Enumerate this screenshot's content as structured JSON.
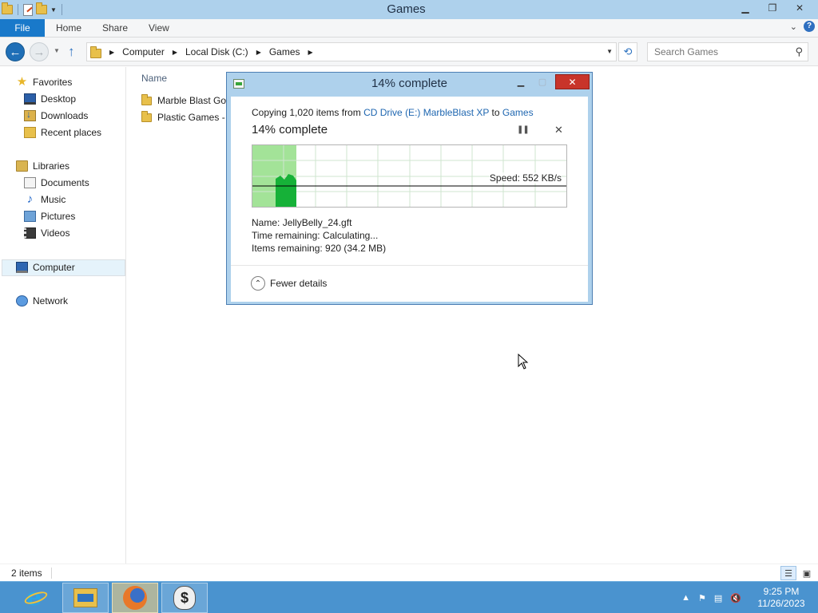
{
  "window": {
    "title": "Games"
  },
  "ribbon": {
    "tabs": [
      "File",
      "Home",
      "Share",
      "View"
    ]
  },
  "address": {
    "crumbs": [
      "Computer",
      "Local Disk (C:)",
      "Games"
    ]
  },
  "search": {
    "placeholder": "Search Games"
  },
  "navpane": {
    "favorites": {
      "label": "Favorites",
      "items": [
        "Desktop",
        "Downloads",
        "Recent places"
      ]
    },
    "libraries": {
      "label": "Libraries",
      "items": [
        "Documents",
        "Music",
        "Pictures",
        "Videos"
      ]
    },
    "computer": "Computer",
    "network": "Network"
  },
  "filelist": {
    "column_name": "Name",
    "items": [
      "Marble Blast Gol",
      "Plastic Games -"
    ]
  },
  "status": {
    "item_count": "2 items"
  },
  "dialog": {
    "title": "14% complete",
    "copy_prefix": "Copying 1,020 items from ",
    "source": "CD Drive (E:) MarbleBlast XP",
    "copy_to": " to ",
    "destination": "Games",
    "percent_heading": "14% complete",
    "progress_fraction": 0.14,
    "speed": "Speed: 552 KB/s",
    "name_label": "Name:",
    "name_value": "JellyBelly_24.gft",
    "time_label": "Time remaining:",
    "time_value": "Calculating...",
    "remaining_label": "Items remaining:",
    "remaining_value": "920 (34.2 MB)",
    "fewer_details": "Fewer details",
    "colors": {
      "progress_fill": "#a3e398",
      "speed_fill": "#16b138"
    }
  },
  "taskbar": {
    "apps": [
      "internet-explorer-icon",
      "file-explorer-icon",
      "firefox-icon",
      "money-bag-icon"
    ],
    "time": "9:25 PM",
    "date": "11/26/2023"
  }
}
